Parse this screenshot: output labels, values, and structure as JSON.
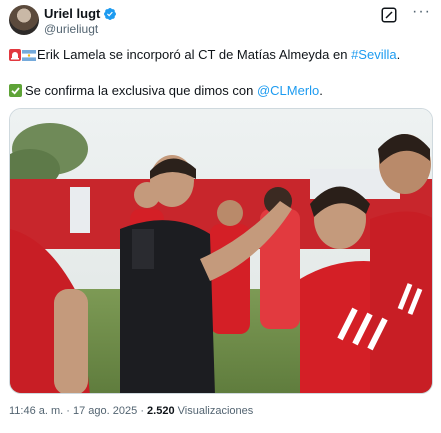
{
  "author": {
    "display_name": "Uriel lugt",
    "handle": "@urieliugt",
    "verified_icon": "verified-badge-icon",
    "avatar_icon": "avatar"
  },
  "tweet": {
    "line1_text": "Erik Lamela se incorporó al CT de Matías Almeyda en ",
    "line1_hashtag": "#Sevilla",
    "line1_end": ".",
    "line2_text": "Se confirma la exclusiva que dimos con ",
    "line2_mention": "@CLMerlo",
    "line2_end": "."
  },
  "meta": {
    "time": "11:46 a. m.",
    "separator": "·",
    "date": "17 ago. 2025",
    "views_count": "2.520",
    "views_label": "Visualizaciones"
  },
  "colors": {
    "link": "#1d9bf0",
    "verified": "#1d9bf0",
    "kit_red": "#d41f26"
  }
}
